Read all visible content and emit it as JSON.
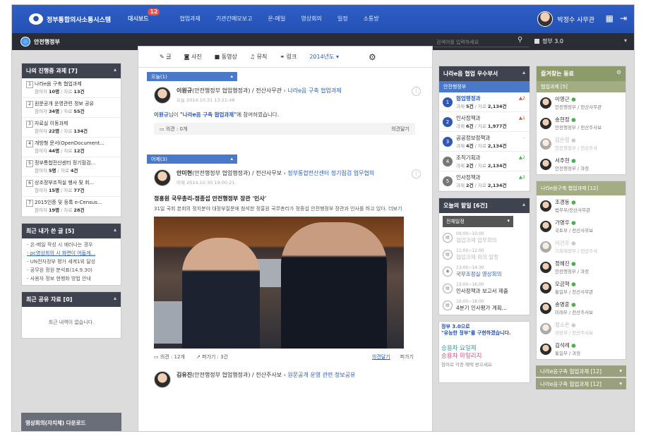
{
  "topbar": {
    "logo_text": "정부통합의사소통시스템",
    "nav": [
      {
        "label": "대시보드",
        "badge": "12",
        "active": true
      },
      {
        "label": "협업과제"
      },
      {
        "label": "기관간메모보고"
      },
      {
        "label": "온-메일"
      },
      {
        "label": "영상회의"
      },
      {
        "label": "일정"
      },
      {
        "label": "소통방"
      }
    ],
    "user_name": "박정수 사무관"
  },
  "subbar": {
    "org_name": "안전행정부",
    "search_placeholder": "검색어를 입력하세요",
    "gov_label": "정부 3.0"
  },
  "left": {
    "tasks_title": "나의 진행중 과제",
    "tasks_count": "[7]",
    "tasks": [
      {
        "num": "1",
        "title": "나라e음 구축 협업과제",
        "stats_prefix": "참여자",
        "participants": "10명",
        "sep": " / 자료 ",
        "docs": "13건"
      },
      {
        "num": "2",
        "title": "원문공개 운영관련 정보 공유",
        "stats_prefix": "참여자",
        "participants": "34명",
        "sep": " / 자료 ",
        "docs": "55건"
      },
      {
        "num": "3",
        "title": "자료실 이동과제",
        "stats_prefix": "참여자",
        "participants": "22명",
        "sep": " / 자료 ",
        "docs": "134건"
      },
      {
        "num": "4",
        "title": "개방형 문서(OpenDocument...",
        "stats_prefix": "참여자",
        "participants": "44명",
        "sep": " / 자료 ",
        "docs": "12건"
      },
      {
        "num": "5",
        "title": "정부통합전산센터 정기점검...",
        "stats_prefix": "참여자",
        "participants": "5명",
        "sep": " / 자료 ",
        "docs": "4건"
      },
      {
        "num": "6",
        "title": "상조정부조직실 행사 및 회...",
        "stats_prefix": "참여자",
        "participants": "15명",
        "sep": " / 자료 ",
        "docs": "77건"
      },
      {
        "num": "7",
        "title": "2015인증 및 등록 e-Census...",
        "stats_prefix": "참여자",
        "participants": "19명",
        "sep": " / 자료 ",
        "docs": "28건"
      }
    ],
    "recent_title": "최근 내가 쓴 글",
    "recent_count": "[5]",
    "recent": [
      "- 온-메일 작성 시 에러나는 경우",
      "- pc영상회의 시 화면이 어둡게...",
      "- UN전자정부 평가 세계1위 달성",
      "- 공무원 정원 분석표(14.9.30)",
      "- 사용자 정보 현행화 방법 안내"
    ],
    "shared_title": "최근 공유 자료",
    "shared_count": "[0]",
    "shared_empty": "최근 내역이 없습니다.",
    "bottom_label": "영상회의(자치체) 다운로드"
  },
  "main": {
    "toolbar": [
      {
        "icon": "글",
        "label": "글"
      },
      {
        "icon": "사진",
        "label": "사진"
      },
      {
        "icon": "동영상",
        "label": "동영상"
      },
      {
        "icon": "뮤직",
        "label": "뮤직"
      },
      {
        "icon": "링크",
        "label": "링크"
      }
    ],
    "year_select": "2014년도",
    "today_label": "오늘(1)",
    "yesterday_label": "어제(3)",
    "post1": {
      "author": "이원규",
      "dept": "(안전행정부 협업행정과)",
      "role": " / 전산사무관 ",
      "arrow": "›",
      "task": "나라e음 구축 협업과제",
      "date": "오늘 2014.10.31   13:21:48",
      "body_prefix": "이원규",
      "body_mid": "님이 ",
      "body_task": "\"나라e음 구축 협업과제\"",
      "body_suffix": "에 참여하였습니다.",
      "comments": "의견 : 0개",
      "write": "의견달기"
    },
    "post2": {
      "author": "안미현",
      "dept": "(안전행정부 협업행정과)",
      "role": " / 전산사무보 ",
      "arrow": "›",
      "task": "정부통합전산센터 정기점검 업무협의",
      "date": "어제 2014.10.30   19:00:21",
      "title": "정홍원 국무총리-정종섭 안전행정부 장관 '인사'",
      "text": "31일 국회 본회의 정치분야 대정부질문에 참석한 정홍원 국무총리가 정종섭 안전행정부 장관과 인사를 하고 있다.",
      "more": "더보기",
      "comments": "의견 : 12개",
      "shares": "퍼가기 : 3건",
      "write": "의견달기",
      "share_btn": "퍼가기"
    },
    "post3": {
      "author": "김유진",
      "dept": "(안전행정부 협업행정과)",
      "role": " / 전산주사보 ",
      "arrow": "›",
      "task": "원문공개 운영 관련 정보공유"
    }
  },
  "right1": {
    "best_title": "나라e음 협업 우수부서",
    "best_sub": "안전행정부",
    "ranks": [
      {
        "n": "1",
        "name": "협업행정과",
        "tasks": "5건",
        "docs": "2,134건",
        "change": "▲2",
        "up": true
      },
      {
        "n": "2",
        "name": "인사정책과",
        "tasks": "6건",
        "docs": "1,977건",
        "change": "▲1",
        "up": true
      },
      {
        "n": "3",
        "name": "공공정보정책과",
        "tasks": "4건",
        "docs": "2,134건",
        "change": "-",
        "up": false
      },
      {
        "n": "4",
        "name": "조직기획과",
        "tasks": "2건",
        "docs": "2,134건",
        "change": "▲2",
        "up": false
      },
      {
        "n": "5",
        "name": "인사정책과",
        "tasks": "2건",
        "docs": "2,134건",
        "change": "▲3",
        "up": false
      }
    ],
    "rank_tasks_label": "과제 ",
    "rank_docs_label": " / 자료 ",
    "today_title": "오늘의 할일",
    "today_count": "[6건]",
    "today_select": "전체일정",
    "events": [
      {
        "time": "09:00~10:00",
        "title": "협업과제 업무회의",
        "faded": true
      },
      {
        "time": "11:00~12:00",
        "title": "협업과제 회의 일정",
        "faded": true
      },
      {
        "time": "13:00~14:30",
        "title": "국무조정실 영상회의",
        "faded": false,
        "blue": true
      },
      {
        "time": "15:00~16:00",
        "title": "인사정책과 보고서 제출",
        "faded": false
      },
      {
        "time": "16:00~18:00",
        "title": "4분기 인사평가 계획...",
        "faded": false
      }
    ],
    "banner_line1": "정부 3.0으로",
    "banner_line2": "\"유능한 정부\"를 구현하겠습니다.",
    "banner_big1": "승용차 요일제",
    "banner_big2": "승용차 마일리지",
    "banner_small": "참여로 각종 혜택 받으세요"
  },
  "right2": {
    "fav_title": "즐겨찾는 동료",
    "fav_sub": "협업과제",
    "fav_sub_count": "[5]",
    "favs": [
      {
        "name": "이영근",
        "org": "안전행정부 / 전산사무관",
        "faded": false
      },
      {
        "name": "송현정",
        "org": "안전행정부 / 전산주사보",
        "faded": false
      },
      {
        "name": "김은정",
        "org": "안전행정부 / 전산주사",
        "faded": true
      },
      {
        "name": "서주현",
        "org": "안전행정부 / 과장",
        "faded": false
      }
    ],
    "coop_title": "나라e음구축 협업과제",
    "coop_count": "[12]",
    "coop": [
      {
        "name": "조경동",
        "org": "법무부/전산사무관",
        "faded": false
      },
      {
        "name": "가명우",
        "org": "국토부 / 전산사무보",
        "faded": false
      },
      {
        "name": "이건우",
        "org": "기획재정부 / 전산주사",
        "faded": true
      },
      {
        "name": "정혜진",
        "org": "안전행정부 / 과장",
        "faded": false
      },
      {
        "name": "오금혁",
        "org": "통일부 / 전산사무관",
        "faded": false
      },
      {
        "name": "송명훈",
        "org": "미래부 / 전산주사보",
        "faded": false
      },
      {
        "name": "정소은",
        "org": "국방부 / 전산주사보",
        "faded": true
      },
      {
        "name": "김석례",
        "org": "통일부 / 과장",
        "faded": false
      }
    ],
    "bottom1": "나라e음구축 협업과제",
    "bottom1_count": "[12]",
    "bottom2": "나라e음구축 협업과제",
    "bottom2_count": "[12]"
  }
}
